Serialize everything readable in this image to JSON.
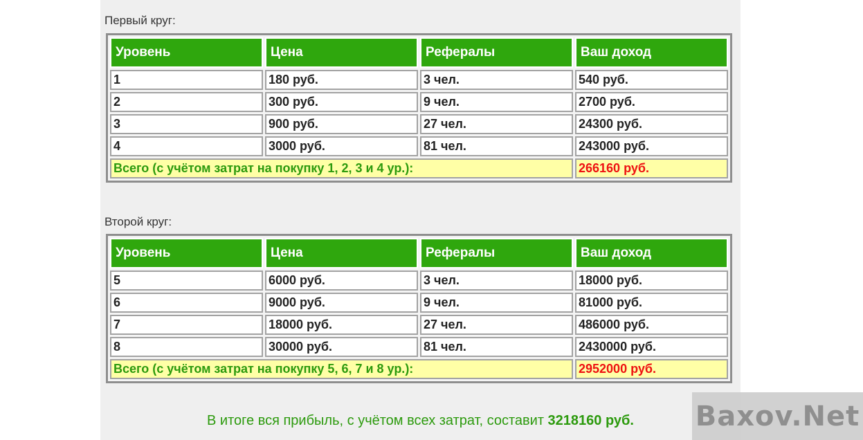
{
  "circles": [
    {
      "title": "Первый круг:",
      "headers": [
        "Уровень",
        "Цена",
        "Рефералы",
        "Ваш доход"
      ],
      "rows": [
        [
          "1",
          "180 руб.",
          "3 чел.",
          "540 руб."
        ],
        [
          "2",
          "300 руб.",
          "9 чел.",
          "2700 руб."
        ],
        [
          "3",
          "900 руб.",
          "27 чел.",
          "24300 руб."
        ],
        [
          "4",
          "3000 руб.",
          "81 чел.",
          "243000 руб."
        ]
      ],
      "total_label": "Всего (с учётом затрат на покупку 1, 2, 3 и 4 ур.):",
      "total_value": "266160 руб."
    },
    {
      "title": "Второй круг:",
      "headers": [
        "Уровень",
        "Цена",
        "Рефералы",
        "Ваш доход"
      ],
      "rows": [
        [
          "5",
          "6000 руб.",
          "3 чел.",
          "18000 руб."
        ],
        [
          "6",
          "9000 руб.",
          "9 чел.",
          "81000 руб."
        ],
        [
          "7",
          "18000 руб.",
          "27 чел.",
          "486000 руб."
        ],
        [
          "8",
          "30000 руб.",
          "81 чел.",
          "2430000 руб."
        ]
      ],
      "total_label": "Всего (с учётом затрат на покупку 5, 6, 7 и 8 ур.):",
      "total_value": "2952000 руб."
    }
  ],
  "summary": {
    "text": "В итоге вся прибыль, с учётом всех затрат, составит ",
    "amount": "3218160 руб."
  },
  "watermark": "Baxov.Net",
  "colors": {
    "header_green": "#2fa70d",
    "total_bg": "#ffffa6",
    "total_text": "#2c9a0d",
    "total_sum": "#ee1010"
  }
}
